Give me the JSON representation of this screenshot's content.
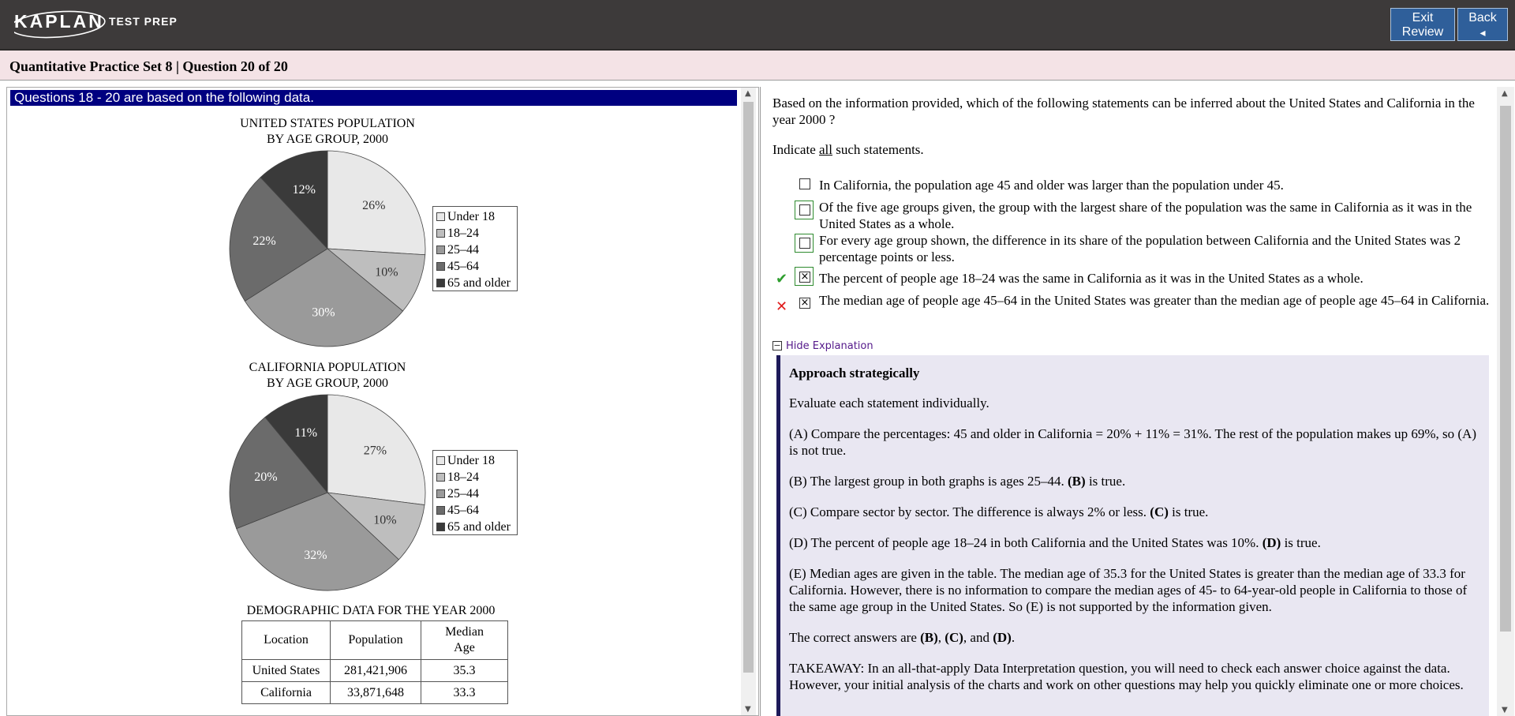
{
  "header": {
    "brand": "KAPLAN",
    "brand_sub": "TEST PREP",
    "exit_review_line1": "Exit",
    "exit_review_line2": "Review",
    "back_label": "Back",
    "back_arrow": "◂"
  },
  "subheader": {
    "title": "Quantitative Practice Set 8 | Question  20 of 20"
  },
  "stimulus": {
    "heading": "Questions 18 - 20 are based on the following data.",
    "us_title_line1": "UNITED STATES POPULATION",
    "us_title_line2": "BY AGE GROUP, 2000",
    "ca_title_line1": "CALIFORNIA POPULATION",
    "ca_title_line2": "BY AGE GROUP, 2000",
    "legend": [
      "Under 18",
      "18–24",
      "25–44",
      "45–64",
      "65 and older"
    ],
    "table_title": "DEMOGRAPHIC DATA FOR THE YEAR 2000",
    "table_headers": [
      "Location",
      "Population",
      "Median",
      "Age"
    ],
    "table_rows": [
      [
        "United States",
        "281,421,906",
        "35.3"
      ],
      [
        "California",
        "33,871,648",
        "33.3"
      ]
    ]
  },
  "chart_data": [
    {
      "type": "pie",
      "title": "UNITED STATES POPULATION BY AGE GROUP, 2000",
      "categories": [
        "Under 18",
        "18–24",
        "25–44",
        "45–64",
        "65 and older"
      ],
      "values": [
        26,
        10,
        30,
        22,
        12
      ],
      "labels": [
        "26%",
        "10%",
        "30%",
        "22%",
        "12%"
      ],
      "colors": [
        "#e8e8e8",
        "#bebebe",
        "#9a9a9a",
        "#6b6b6b",
        "#3a3a3a"
      ],
      "legend_position": "right"
    },
    {
      "type": "pie",
      "title": "CALIFORNIA POPULATION BY AGE GROUP, 2000",
      "categories": [
        "Under 18",
        "18–24",
        "25–44",
        "45–64",
        "65 and older"
      ],
      "values": [
        27,
        10,
        32,
        20,
        11
      ],
      "labels": [
        "27%",
        "10%",
        "32%",
        "20%",
        "11%"
      ],
      "colors": [
        "#e8e8e8",
        "#bebebe",
        "#9a9a9a",
        "#6b6b6b",
        "#3a3a3a"
      ],
      "legend_position": "right"
    },
    {
      "type": "table",
      "title": "DEMOGRAPHIC DATA FOR THE YEAR 2000",
      "columns": [
        "Location",
        "Population",
        "Median Age"
      ],
      "rows": [
        [
          "United States",
          "281,421,906",
          "35.3"
        ],
        [
          "California",
          "33,871,648",
          "33.3"
        ]
      ]
    }
  ],
  "question": {
    "text": "Based on the information provided, which of the following statements can be inferred about the United States and California in the year 2000 ?",
    "indicate_prefix": "Indicate ",
    "indicate_underline": "all",
    "indicate_suffix": " such statements.",
    "choices": [
      {
        "text": "In California, the population age 45 and older was larger than the population under 45.",
        "checked": false,
        "framed": false,
        "mark": ""
      },
      {
        "text": "Of the five age groups given, the group with the largest share of the population was the same in California as it was in the United States as a whole.",
        "checked": false,
        "framed": true,
        "mark": ""
      },
      {
        "text": "For every age group shown, the difference in its share of the population between California and the United States was 2 percentage points or less.",
        "checked": false,
        "framed": true,
        "mark": ""
      },
      {
        "text": "The percent of people age 18–24 was the same in California as it was in the United States as a whole.",
        "checked": true,
        "framed": true,
        "mark": "✔"
      },
      {
        "text": "The median age of people age 45–64 in the United States was greater than the median age of people age 45–64 in California.",
        "checked": true,
        "framed": false,
        "mark": "✕"
      }
    ],
    "check_color": "#2e9e2e",
    "cross_color": "#e01b1b"
  },
  "explanation": {
    "toggle_label": "Hide Explanation",
    "heading": "Approach strategically",
    "p1": "Evaluate each statement individually.",
    "pA": "(A) Compare the percentages: 45 and older in California = 20% + 11% = 31%. The rest of the population makes up 69%, so (A) is not true.",
    "pB_text": "(B) The largest group in both graphs is ages 25–44. ",
    "pB_bold": "(B)",
    "pB_end": " is true.",
    "pC_text": "(C) Compare sector by sector. The difference is always 2% or less. ",
    "pC_bold": "(C)",
    "pC_end": " is true.",
    "pD_text": "(D) The percent of people age 18–24 in both California and the United States was 10%. ",
    "pD_bold": "(D)",
    "pD_end": " is true.",
    "pE": "(E) Median ages are given in the table. The median age of 35.3 for the United States is greater than the median age of 33.3 for California. However, there is no information to compare the median ages of 45- to 64-year-old people in California to those of the same age group in the United States. So (E) is not supported by the information given.",
    "answers_prefix": "The correct answers are ",
    "answer_b": "(B)",
    "answers_sep1": ", ",
    "answer_c": "(C)",
    "answers_sep2": ", and ",
    "answer_d": "(D)",
    "answers_end": ".",
    "takeaway": "TAKEAWAY: In an all-that-apply Data Interpretation question, you will need to check each answer choice against the data. However, your initial analysis of the charts and work on other questions may help you quickly eliminate one or more choices."
  }
}
